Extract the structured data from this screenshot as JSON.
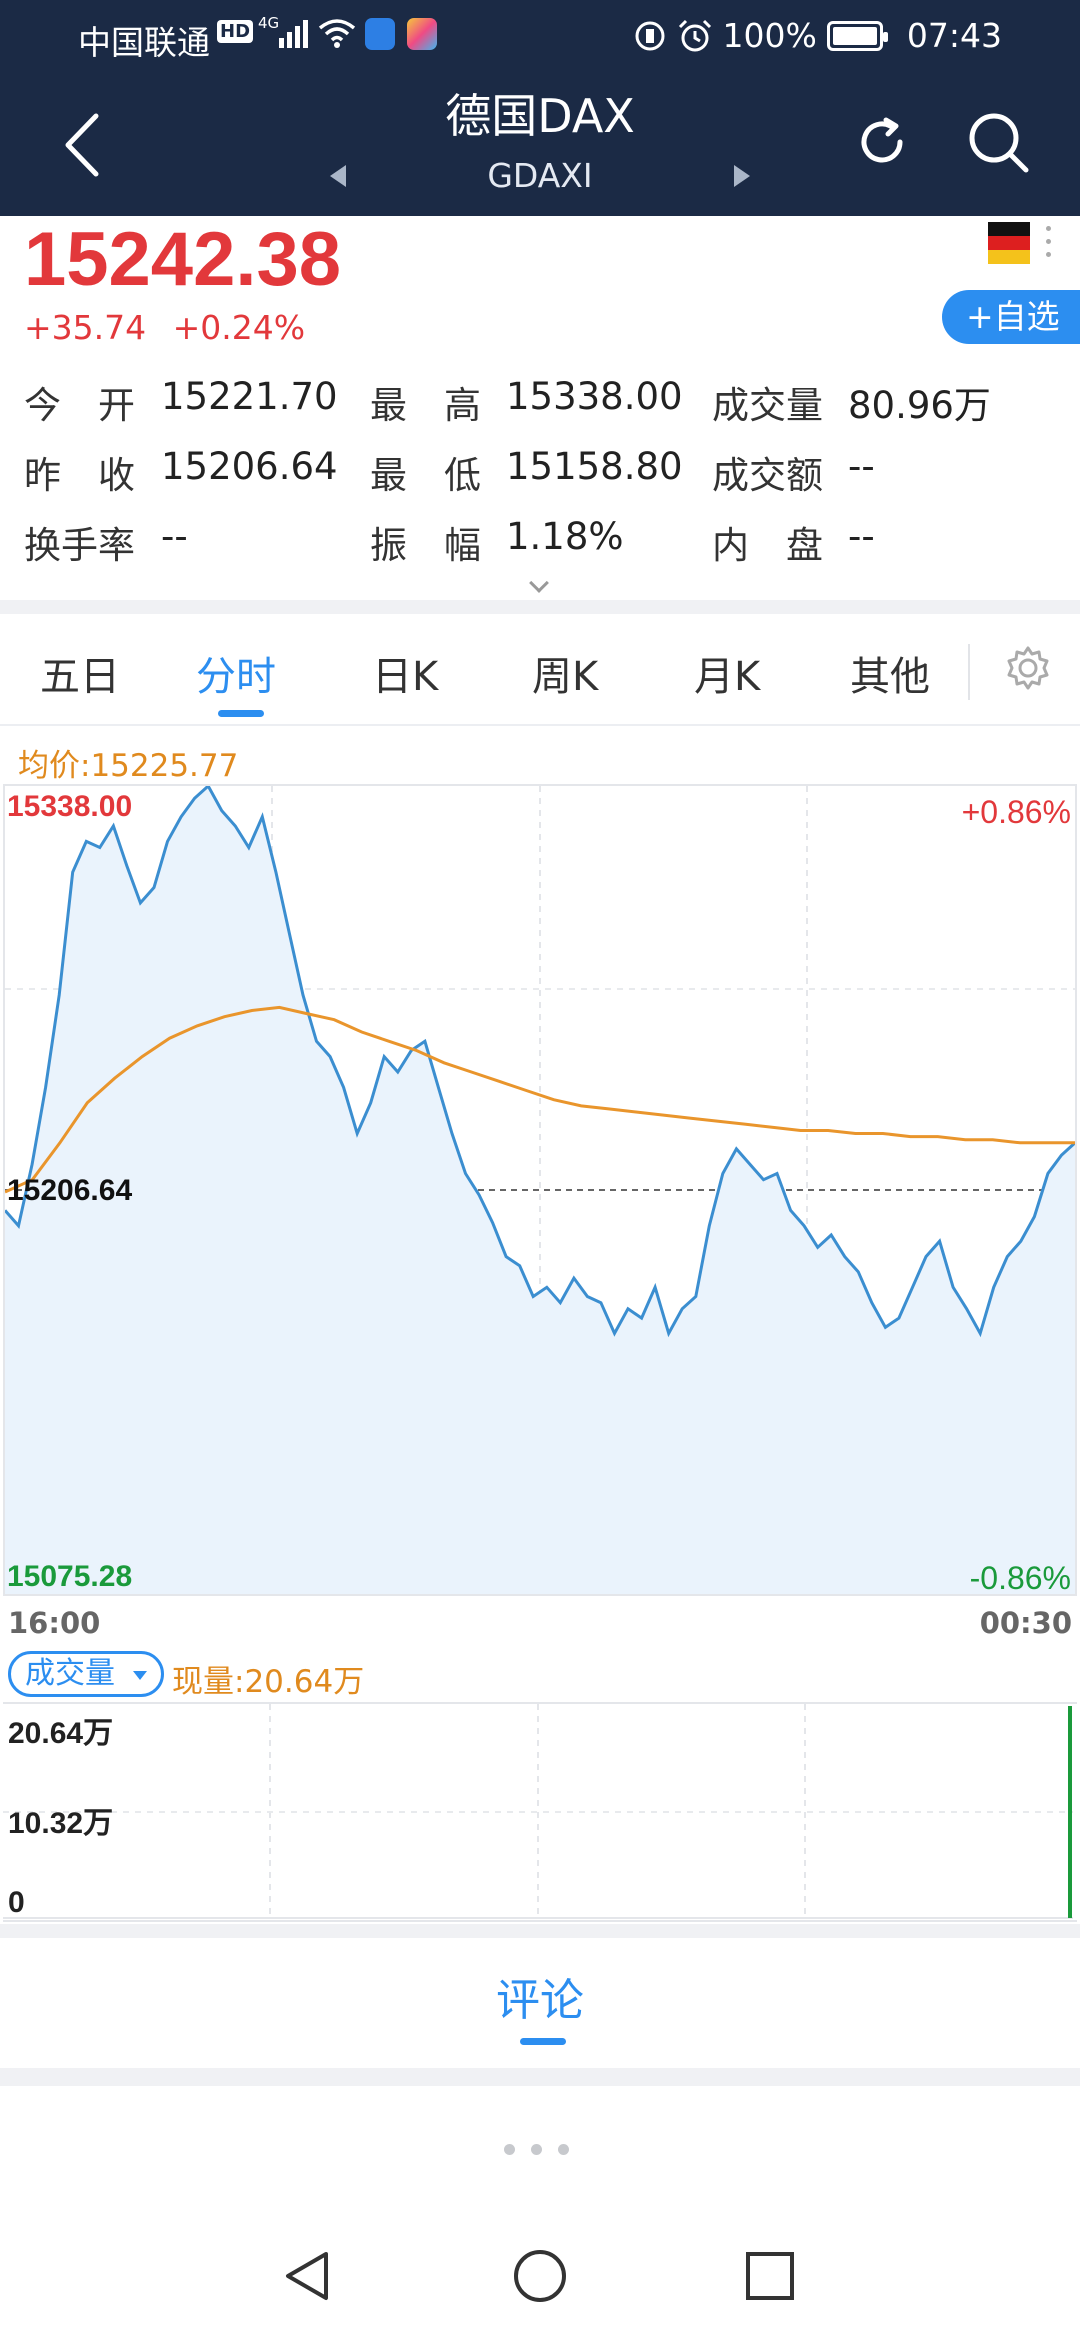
{
  "status_bar": {
    "carrier": "中国联通",
    "hd": "HD",
    "network": "4G",
    "battery": "100%",
    "time": "07:43",
    "icons": [
      "signal-icon",
      "wifi-icon",
      "alarm-icon",
      "vibrate-icon",
      "battery-icon"
    ]
  },
  "header": {
    "title": "德国DAX",
    "code": "GDAXI"
  },
  "quote": {
    "price": "15242.38",
    "change": "+35.74",
    "change_pct": "+0.24%",
    "add_watchlist": "+自选",
    "flag": "germany-flag-icon",
    "colors": {
      "up": "#e2383b",
      "down": "#1a9a3b",
      "accent": "#2c8ef0",
      "avg": "#e08a1e"
    }
  },
  "stats": [
    [
      {
        "label": "今　开",
        "value": "15221.70"
      },
      {
        "label": "最　高",
        "value": "15338.00"
      },
      {
        "label": "成交量",
        "value": "80.96万"
      }
    ],
    [
      {
        "label": "昨　收",
        "value": "15206.64"
      },
      {
        "label": "最　低",
        "value": "15158.80"
      },
      {
        "label": "成交额",
        "value": "--"
      }
    ],
    [
      {
        "label": "换手率",
        "value": "--"
      },
      {
        "label": "振　幅",
        "value": "1.18%"
      },
      {
        "label": "内　盘",
        "value": "--"
      }
    ]
  ],
  "tabs": [
    {
      "label": "五日"
    },
    {
      "label": "分时",
      "active": true
    },
    {
      "label": "日K"
    },
    {
      "label": "周K"
    },
    {
      "label": "月K"
    },
    {
      "label": "其他"
    }
  ],
  "chart": {
    "avg_label": "均价:15225.77",
    "y_max": "15338.00",
    "y_prev_close": "15206.64",
    "y_min": "15075.28",
    "pct_max": "+0.86%",
    "pct_min": "-0.86%",
    "time_start": "16:00",
    "time_end": "00:30"
  },
  "chart_data": {
    "type": "line",
    "ylim": [
      15075.28,
      15338.0
    ],
    "reference": 15206.64,
    "series": [
      {
        "values": [
          15200,
          15195,
          15215,
          15240,
          15270,
          15310,
          15320,
          15318,
          15325,
          15312,
          15300,
          15305,
          15320,
          15328,
          15334,
          15338,
          15330,
          15325,
          15318,
          15328,
          15310,
          15290,
          15270,
          15255,
          15250,
          15240,
          15225,
          15235,
          15250,
          15245,
          15252,
          15255,
          15240,
          15225,
          15212,
          15205,
          15196,
          15185,
          15182,
          15172,
          15175,
          15170,
          15178,
          15172,
          15170,
          15160,
          15168,
          15165,
          15175,
          15160,
          15168,
          15172,
          15195,
          15212,
          15220,
          15215,
          15210,
          15212,
          15200,
          15195,
          15188,
          15192,
          15185,
          15180,
          15170,
          15162,
          15165,
          15175,
          15185,
          15190,
          15175,
          15168,
          15160,
          15175,
          15185,
          15190,
          15198,
          15212,
          15218,
          15222
        ]
      },
      {
        "values": [
          15206,
          15210,
          15222,
          15235,
          15243,
          15250,
          15256,
          15260,
          15263,
          15265,
          15266,
          15264,
          15262,
          15258,
          15255,
          15252,
          15248,
          15245,
          15242,
          15239,
          15236,
          15234,
          15233,
          15232,
          15231,
          15230,
          15229,
          15228,
          15227,
          15226,
          15226,
          15225,
          15225,
          15224,
          15224,
          15223,
          15223,
          15222,
          15222,
          15222
        ]
      }
    ]
  },
  "volume": {
    "selector": "成交量",
    "now": "现量:20.64万",
    "max": "20.64万",
    "mid": "10.32万",
    "zero": "0"
  },
  "comment": {
    "label": "评论"
  }
}
